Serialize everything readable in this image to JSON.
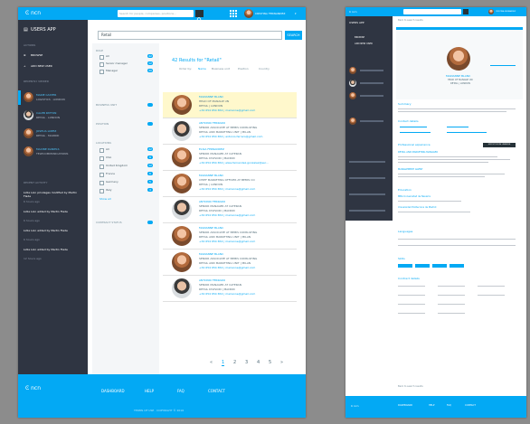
{
  "app": {
    "logo": "Ͼ ncn",
    "search_placeholder": "Search for people, companies, positions...",
    "user_name": "CRISTINA FERNANDEZ"
  },
  "left_sidebar": {
    "app_title": "USERS APP",
    "actions_heading": "ACTIONS",
    "actions": [
      "BROWSE",
      "ADD NEW USER"
    ],
    "recent_heading": "RECENTLY VIEWED",
    "recent_users": [
      {
        "name": "MARIE CASTER",
        "role": "LOGISTICS · LONDON"
      },
      {
        "name": "CALEB PATTON",
        "role": "RETAIL · LONDON"
      },
      {
        "name": "JOSHUA LOPEZ",
        "role": "RETAIL · MADRID"
      },
      {
        "name": "MAXINE DANIELS",
        "role": "TELECOMMUNICATIONS"
      }
    ],
    "activity_heading": "RECENT ACTIVITY",
    "activity": [
      {
        "text": "Lidia Lion privileges modified by Martin Flade",
        "time": "6 hours ago"
      },
      {
        "text": "Lidia Lion added by Martin Flade",
        "time": "6 hours ago"
      },
      {
        "text": "Lidia Lion added by Martin Flade",
        "time": "6 hours ago"
      },
      {
        "text": "Lidia Lion added by Martin Flade",
        "time": "12 hours ago"
      }
    ]
  },
  "search": {
    "query": "Retail",
    "button": "SEARCH"
  },
  "filters": {
    "role_heading": "ROLE",
    "role_options": [
      {
        "label": "All",
        "count": "42"
      },
      {
        "label": "Senior manager",
        "count": "12"
      },
      {
        "label": "Manager",
        "count": "30"
      }
    ],
    "business_unit_heading": "BUSINESS UNIT",
    "position_heading": "POSITION",
    "locations_heading": "LOCATIONS",
    "locations": [
      {
        "label": "All",
        "count": "42"
      },
      {
        "label": "USA",
        "count": "8"
      },
      {
        "label": "United Kingdom",
        "count": "12"
      },
      {
        "label": "France",
        "count": "6"
      },
      {
        "label": "Germany",
        "count": "5"
      },
      {
        "label": "Italy",
        "count": "4"
      }
    ],
    "show_all": "Show all",
    "contract_heading": "CONTRACT STATUS"
  },
  "results": {
    "title": "42 Results for \"Retail\"",
    "order_by_label": "Order by:",
    "order_options": [
      "Name",
      "Business unit",
      "Position",
      "Country"
    ],
    "items": [
      {
        "name": "MARIANNE BLANC",
        "position": "HEAD OF MANAGE UN",
        "unit": "RETAIL | LONDON",
        "contact": "+34 654 654 654 | marianne@gmail.com",
        "gender": "f",
        "highlight": true
      },
      {
        "name": "ANTONIO FERRARO",
        "position": "SENIOR ASSOCIATE AT BEMIS CONSULTING",
        "unit": "RETAIL AND MARKETING UNIT | MILAN",
        "contact": "+34 654 654 654 | antonio.ferraro@gmail.com",
        "gender": "m",
        "highlight": false
      },
      {
        "name": "ELSIA FERNANDEZ",
        "position": "SENIOR MANAGER AT CATERAN",
        "unit": "RETAIL DIVISION | MADRID",
        "contact": "+34 654 654 654 | elsia.fernandez.gonzalez@ser...",
        "gender": "f",
        "highlight": false
      },
      {
        "name": "MARIANNE BLANC",
        "position": "CHIEF MARKETING OFFICER AT BEMIS CO",
        "unit": "RETAIL | LONDON",
        "contact": "+34 654 654 654 | marianne@gmail.com",
        "gender": "f",
        "highlight": false
      },
      {
        "name": "ANTONIO FERRARO",
        "position": "SENIOR MANAGER AT CATERAN",
        "unit": "RETAIL DIVISION | MADRID",
        "contact": "+34 654 654 654 | marianne@gmail.com",
        "gender": "m",
        "highlight": false
      },
      {
        "name": "MARIANNE BLANC",
        "position": "SENIOR ASSOCIATE AT BEMIS CONSULTING",
        "unit": "RETAIL AND MARKETING UNIT | MILAN",
        "contact": "+34 654 654 654 | marianne@gmail.com",
        "gender": "f",
        "highlight": false
      },
      {
        "name": "MARIANNE BLANC",
        "position": "SENIOR ASSOCIATE AT BEMIS CONSULTING",
        "unit": "RETAIL AND MARKETING UNIT | MILAN",
        "contact": "+34 654 654 654 | marianne@gmail.com",
        "gender": "f",
        "highlight": false
      },
      {
        "name": "ANTONIO FERRARO",
        "position": "SENIOR MANAGER AT CATERAN",
        "unit": "RETAIL DIVISION | MADRID",
        "contact": "+34 654 654 654 | marianne@gmail.com",
        "gender": "m",
        "highlight": false
      }
    ],
    "pagination": [
      "«",
      "1",
      "2",
      "3",
      "4",
      "5",
      "»"
    ],
    "active_page": "1"
  },
  "footer": {
    "links": [
      "DASHBOARD",
      "HELP",
      "FAQ",
      "CONTACT"
    ],
    "copyright": "TERMS OF USE · COPYRIGHT © 2016"
  },
  "detail": {
    "back": "Back to search results",
    "name": "MARIANNE BLANC",
    "position": "HEAD OF MANAGE UN",
    "unit": "RETAIL | LONDON",
    "summary_heading": "Summary",
    "contact_heading": "Contact details",
    "experience_heading": "Professional experience",
    "report_button": "EXPORT FROM LINKEDIN",
    "job1": "RETAIL AND MARKETING MANAGER",
    "job2": "MANAGEMENT AGENT",
    "education_heading": "Education",
    "edu1": "MBA Universidad de Navarra",
    "edu2": "Universidad Politecnica de Madrid",
    "languages_heading": "Languages",
    "skills_heading": "Skills",
    "contract_heading": "Contract details",
    "back_bottom": "Back to search results"
  },
  "colors": {
    "accent": "#03a9f4",
    "sidebar": "#2f3542",
    "highlight": "#fff8cc"
  }
}
